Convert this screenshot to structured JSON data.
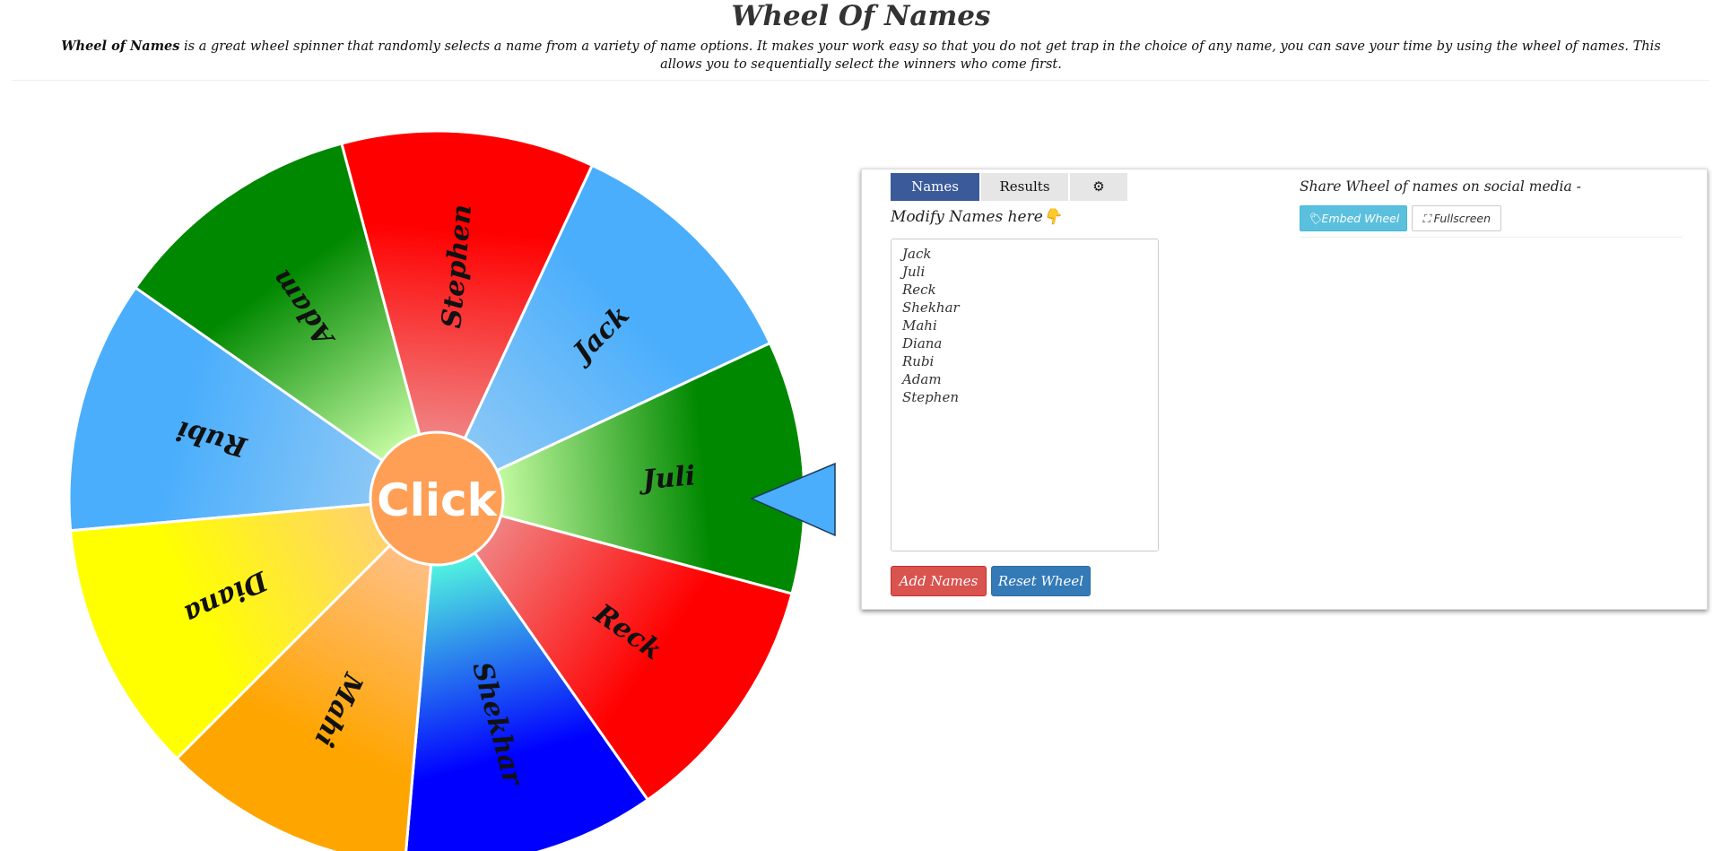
{
  "header": {
    "title": "Wheel Of Names",
    "intro_bold": "Wheel of Names",
    "intro_rest": " is a great wheel spinner that randomly selects a name from a variety of name options. It makes your work easy so that you do not get trap in the choice of any name, you can save your time by using the wheel of names. This allows you to sequentially select the winners who come first."
  },
  "wheel": {
    "center_label": "Click",
    "center_color": "#ff9f55",
    "pointer_color": "#4aaefc",
    "segments": [
      {
        "name": "Rubi",
        "color": "#4aaefc",
        "light": "#8cc8f6"
      },
      {
        "name": "Adam",
        "color": "#008800",
        "light": "#ccffa8"
      },
      {
        "name": "Stephen",
        "color": "#ff0000",
        "light": "#f08888"
      },
      {
        "name": "Jack",
        "color": "#4aaefc",
        "light": "#8cc8f6"
      },
      {
        "name": "Juli",
        "color": "#008800",
        "light": "#ccffa8"
      },
      {
        "name": "Reck",
        "color": "#ff0000",
        "light": "#f08888"
      },
      {
        "name": "Shekhar",
        "color": "#0000ff",
        "light": "#55ffdd"
      },
      {
        "name": "Mahi",
        "color": "#ffa500",
        "light": "#ffc08a"
      },
      {
        "name": "Diana",
        "color": "#ffff00",
        "light": "#ffd070"
      }
    ]
  },
  "panel": {
    "tabs": [
      {
        "label": "Names"
      },
      {
        "label": "Results"
      },
      {
        "label": "⚙"
      }
    ],
    "modify_label": "Modify Names here👇",
    "names": [
      "Jack",
      "Juli",
      "Reck",
      "Shekhar",
      "Mahi",
      "Diana",
      "Rubi",
      "Adam",
      "Stephen"
    ],
    "add_button": "Add Names",
    "reset_button": "Reset Wheel",
    "share_label": "Share Wheel of names on social media -",
    "embed_button": "🏷Embed Wheel",
    "fullscreen_button": "⛶ Fullscreen"
  }
}
